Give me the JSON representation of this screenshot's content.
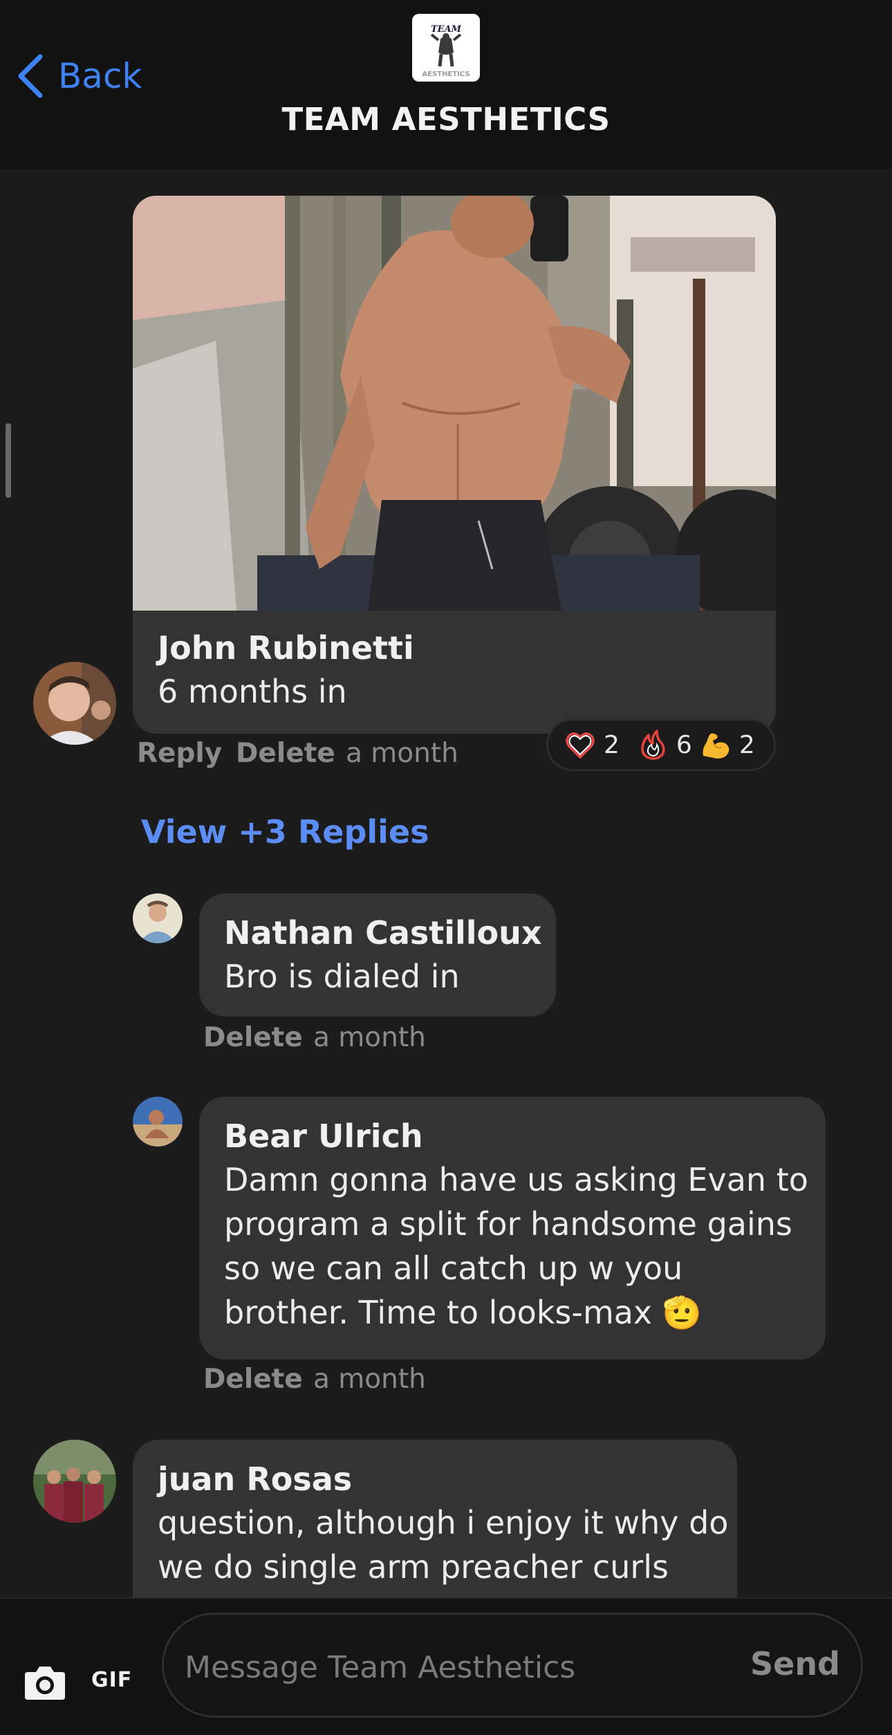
{
  "header": {
    "back_label": "Back",
    "title": "TEAM AESTHETICS",
    "logo_text_top": "TEAM",
    "logo_text_bottom": "AESTHETICS"
  },
  "post": {
    "author": "John Rubinetti",
    "text": "6 months in",
    "reply_label": "Reply",
    "delete_label": "Delete",
    "time": "a month",
    "reactions": [
      {
        "icon": "heart-icon",
        "count": "2"
      },
      {
        "icon": "fire-icon",
        "count": "6"
      },
      {
        "icon": "flexed-biceps-icon",
        "count": "2"
      }
    ]
  },
  "view_replies_label": "View +3 Replies",
  "replies": [
    {
      "author": "Nathan Castilloux",
      "lines": [
        "Bro is dialed in"
      ],
      "delete_label": "Delete",
      "time": "a month"
    },
    {
      "author": "Bear Ulrich",
      "lines": [
        "Damn gonna have us asking Evan to",
        "program a split for handsome gains",
        "so we can all catch up w you",
        "brother. Time to looks-max 🫡"
      ],
      "delete_label": "Delete",
      "time": "a month"
    }
  ],
  "comment": {
    "author": "juan Rosas",
    "lines": [
      "question, although i enjoy it why do",
      "we do single arm preacher curls"
    ]
  },
  "composer": {
    "gif_label": "GIF",
    "placeholder": "Message Team Aesthetics",
    "send_label": "Send"
  },
  "colors": {
    "accent_blue": "#3f82f4",
    "link_blue": "#5b8df5",
    "bubble": "#333334",
    "background": "#1c1c1c",
    "header": "#121212"
  }
}
